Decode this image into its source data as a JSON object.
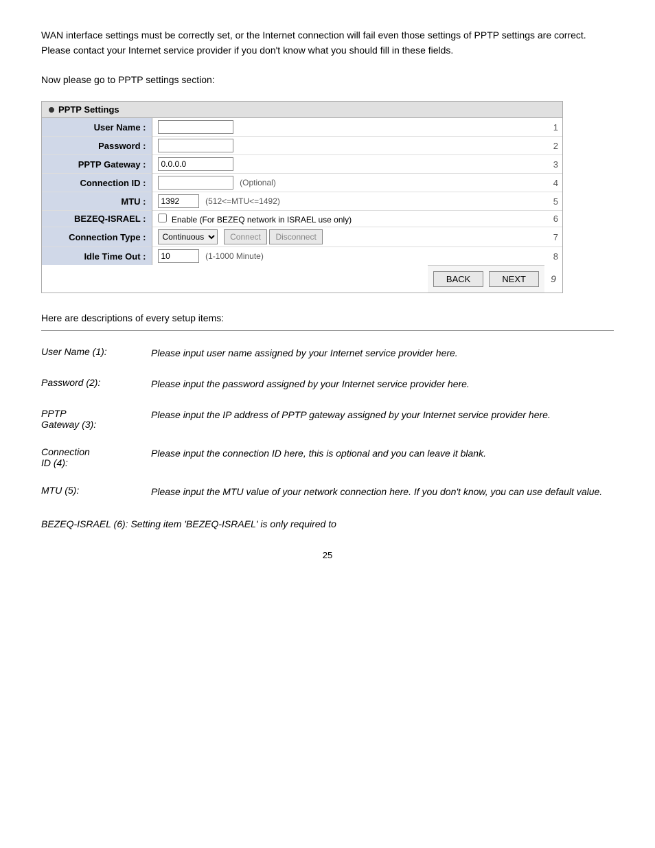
{
  "intro": {
    "para1": "WAN interface settings must be correctly set, or the Internet connection will fail even those settings of PPTP settings are correct. Please contact your Internet service provider if you don't know what you should fill in these fields.",
    "para2": "Now please go to PPTP settings section:"
  },
  "pptp": {
    "header": "PPTP Settings",
    "rows": [
      {
        "label": "User Name :",
        "num": "1"
      },
      {
        "label": "Password :",
        "num": "2"
      },
      {
        "label": "PPTP Gateway :",
        "value": "0.0.0.0",
        "num": "3"
      },
      {
        "label": "Connection ID :",
        "hint": "(Optional)",
        "num": "4"
      },
      {
        "label": "MTU :",
        "value": "1392",
        "hint": "(512<=MTU<=1492)",
        "num": "5"
      },
      {
        "label": "BEZEQ-ISRAEL :",
        "bezeq": "Enable (For BEZEQ network in ISRAEL use only)",
        "num": "6"
      },
      {
        "label": "Connection Type :",
        "connection_type": "Continuous",
        "connect": "Connect",
        "disconnect": "Disconnect",
        "num": "7"
      },
      {
        "label": "Idle Time Out :",
        "value": "10",
        "hint": "(1-1000 Minute)",
        "num": "8"
      }
    ],
    "back_label": "BACK",
    "next_label": "NEXT",
    "btn_num": "9"
  },
  "descriptions": {
    "title": "Here are descriptions of every setup items:",
    "items": [
      {
        "key": "User Name (1):",
        "value": "Please input user name assigned by your Internet service provider here."
      },
      {
        "key": "Password (2):",
        "value": "Please input the password assigned by your Internet service provider here."
      },
      {
        "key": "PPTP\nGateway (3):",
        "value": "Please input the IP address of PPTP gateway assigned by your Internet service provider here."
      },
      {
        "key": "Connection\nID (4):",
        "value": "Please input the connection ID here, this is optional and you can leave it blank."
      },
      {
        "key": "MTU (5):",
        "value": "Please input the MTU value of your network connection here. If you don't know, you can use default value."
      }
    ],
    "bezeq_line": "BEZEQ-ISRAEL (6): Setting item 'BEZEQ-ISRAEL' is only required to"
  },
  "page_number": "25"
}
